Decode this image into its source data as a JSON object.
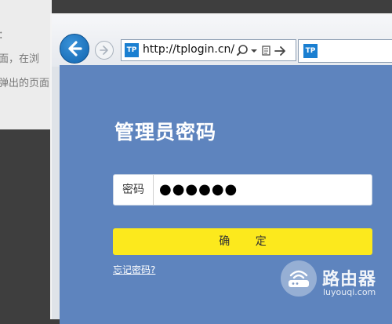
{
  "background_document": {
    "lines": [
      "：",
      "面，在浏",
      "弹出的页面"
    ]
  },
  "browser": {
    "url": "http://tplogin.cn/",
    "favicon_text": "TP",
    "tab_favicon_text": "TP"
  },
  "login": {
    "title": "管理员密码",
    "password_label": "密码",
    "password_value": "●●●●●●",
    "confirm_label": "确 定",
    "forgot_label": "忘记密码?"
  },
  "watermark": {
    "name": "路由器",
    "domain": "luyouqi.com"
  },
  "colors": {
    "page_background": "#5e84be",
    "confirm_button": "#fce91d",
    "back_button": "#1a74c0"
  }
}
